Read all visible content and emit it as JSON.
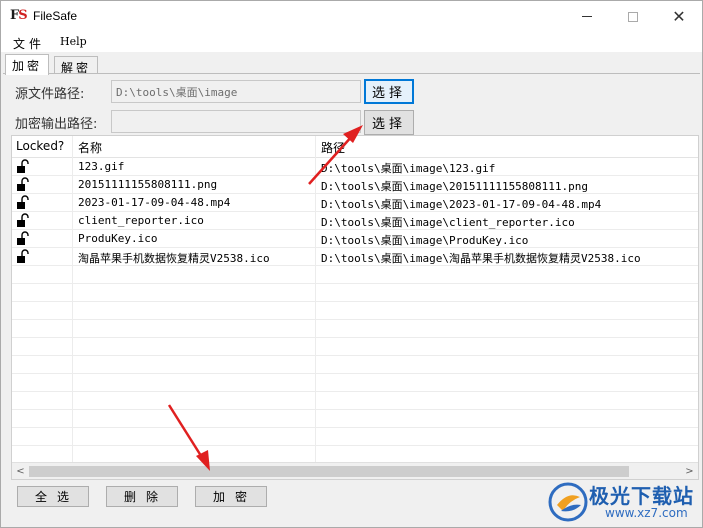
{
  "window": {
    "title": "FileSafe",
    "icon_text_f": "F",
    "icon_text_s": "S"
  },
  "menu": {
    "file": "文件",
    "help": "Help"
  },
  "tabs": [
    {
      "label": "加密",
      "active": true
    },
    {
      "label": "解密",
      "active": false
    }
  ],
  "source": {
    "label": "源文件路径:",
    "value": "D:\\tools\\桌面\\image",
    "button": "选择"
  },
  "output": {
    "label": "加密输出路径:",
    "value": "",
    "button": "选择"
  },
  "table": {
    "columns": [
      "Locked?",
      "名称",
      "路径"
    ],
    "rows": [
      {
        "name": "123.gif",
        "path": "D:\\tools\\桌面\\image\\123.gif"
      },
      {
        "name": "20151111155808111.png",
        "path": "D:\\tools\\桌面\\image\\20151111155808111.png"
      },
      {
        "name": "2023-01-17-09-04-48.mp4",
        "path": "D:\\tools\\桌面\\image\\2023-01-17-09-04-48.mp4"
      },
      {
        "name": "client_reporter.ico",
        "path": "D:\\tools\\桌面\\image\\client_reporter.ico"
      },
      {
        "name": "ProduKey.ico",
        "path": "D:\\tools\\桌面\\image\\ProduKey.ico"
      },
      {
        "name": "淘晶苹果手机数据恢复精灵V2538.ico",
        "path": "D:\\tools\\桌面\\image\\淘晶苹果手机数据恢复精灵V2538.ico"
      }
    ],
    "lock_icon": "unlocked-padlock-icon"
  },
  "buttons": {
    "select_all": "全选",
    "delete": "删除",
    "encrypt": "加密"
  },
  "watermark": {
    "title": "极光下载站",
    "url": "www.xz7.com"
  },
  "colors": {
    "accent": "#0078d7",
    "arrow": "#e02020",
    "watermark": "#1f5fb0"
  }
}
